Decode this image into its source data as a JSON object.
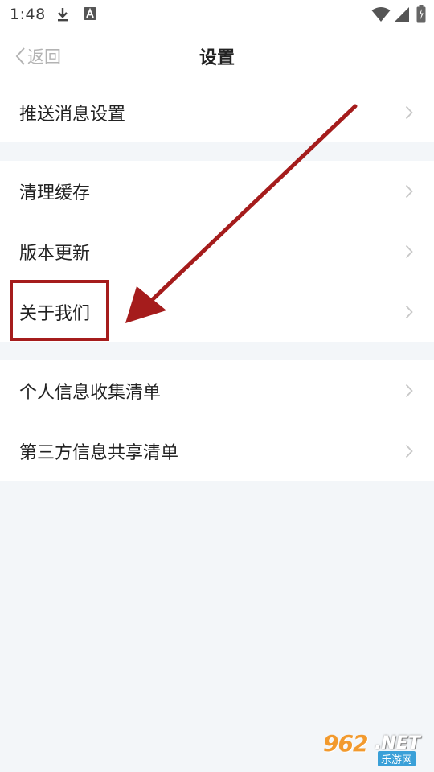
{
  "status_bar": {
    "time": "1:48",
    "icons": [
      "download-icon",
      "font-a-icon",
      "wifi-icon",
      "cellular-signal-icon",
      "battery-charging-icon"
    ]
  },
  "header": {
    "back_label": "返回",
    "title": "设置"
  },
  "groups": [
    {
      "items": [
        {
          "label": "推送消息设置"
        }
      ]
    },
    {
      "items": [
        {
          "label": "清理缓存"
        },
        {
          "label": "版本更新"
        },
        {
          "label": "关于我们"
        }
      ]
    },
    {
      "items": [
        {
          "label": "个人信息收集清单"
        },
        {
          "label": "第三方信息共享清单"
        }
      ]
    }
  ],
  "annotation": {
    "color": "#a51c1c",
    "target": "关于我们"
  },
  "watermark": {
    "brand": "962",
    "suffix": ".NET",
    "subtitle": "乐游网"
  },
  "colors": {
    "background": "#f3f6f9",
    "card": "#ffffff",
    "chevron": "#c8c8c8",
    "back": "#b3b3b3"
  }
}
